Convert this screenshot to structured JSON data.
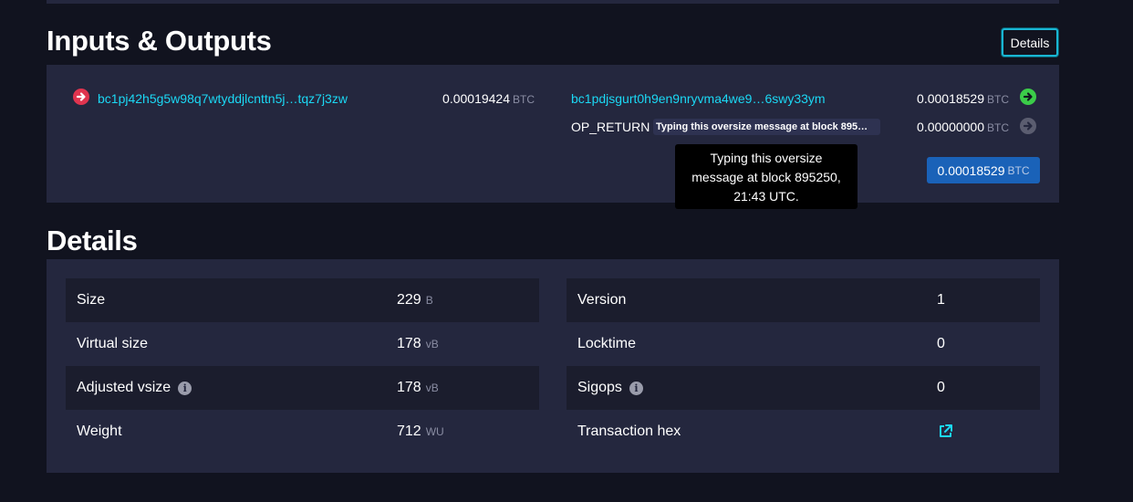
{
  "inputs_outputs": {
    "title": "Inputs & Outputs",
    "details_button": "Details",
    "input": {
      "address": "bc1pj42h5g5w98q7wtyddjlcnttn5j…tqz7j3zw",
      "amount": "0.00019424",
      "unit": "BTC"
    },
    "outputs": [
      {
        "address": "bc1pdjsgurt0h9en9nryvma4we9…6swy33ym",
        "amount": "0.00018529",
        "unit": "BTC"
      },
      {
        "label": "OP_RETURN",
        "message": "Typing this oversize message at block 895…",
        "amount": "0.00000000",
        "unit": "BTC"
      }
    ],
    "total": {
      "amount": "0.00018529",
      "unit": "BTC"
    },
    "tooltip": {
      "line1": "Typing this oversize",
      "line2": "message at block 895250,",
      "line3": "21:43 UTC."
    }
  },
  "details": {
    "title": "Details",
    "left": [
      {
        "label": "Size",
        "value": "229",
        "unit": "B"
      },
      {
        "label": "Virtual size",
        "value": "178",
        "unit": "vB"
      },
      {
        "label": "Adjusted vsize",
        "value": "178",
        "unit": "vB"
      },
      {
        "label": "Weight",
        "value": "712",
        "unit": "WU"
      }
    ],
    "right": [
      {
        "label": "Version",
        "value": "1"
      },
      {
        "label": "Locktime",
        "value": "0"
      },
      {
        "label": "Sigops",
        "value": "0"
      },
      {
        "label": "Transaction hex"
      }
    ]
  },
  "colors": {
    "background": "#11131f",
    "panel": "#24273e",
    "row_stripe": "#1b1d2d",
    "link": "#1bd8f4",
    "input_arrow": "#e0344f",
    "output_arrow": "#3bcc49",
    "spent_arrow": "#5b5d70",
    "total_badge": "#1a62b8"
  },
  "icons": {
    "input": "arrow-right-circle-red",
    "output": "arrow-right-circle-green",
    "op_return": "arrow-right-circle-gray",
    "info": "info-circle",
    "external": "external-link"
  }
}
